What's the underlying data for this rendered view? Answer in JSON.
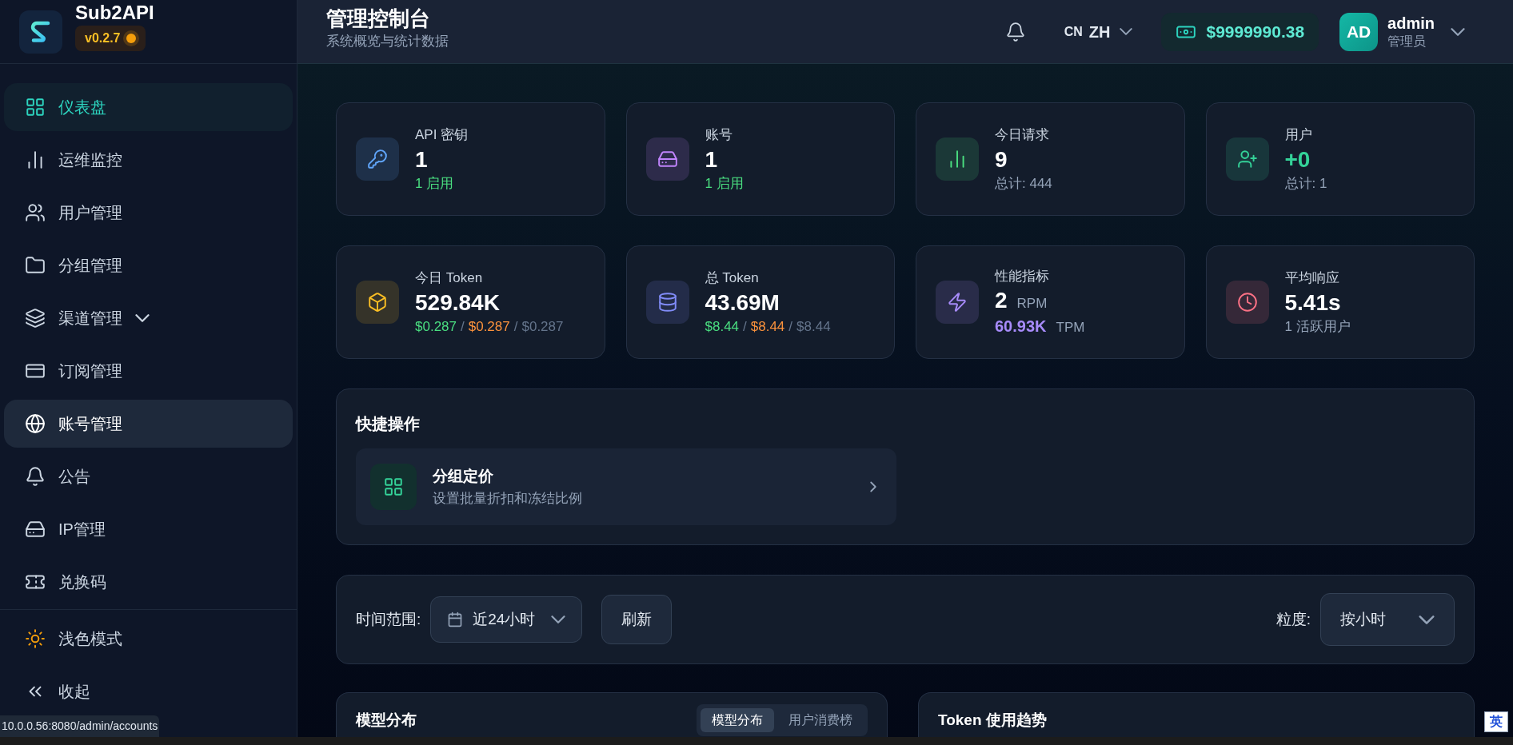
{
  "app": {
    "name": "Sub2API",
    "version": "v0.2.7"
  },
  "header": {
    "title": "管理控制台",
    "subtitle": "系统概览与统计数据",
    "language": {
      "code": "CN",
      "label": "ZH"
    },
    "balance": "$9999990.38",
    "user": {
      "initials": "AD",
      "name": "admin",
      "role": "管理员"
    }
  },
  "sidebar": {
    "items": [
      {
        "label": "仪表盘",
        "kind": "link",
        "selected": true,
        "hovered": false
      },
      {
        "label": "运维监控",
        "kind": "link",
        "selected": false,
        "hovered": false
      },
      {
        "label": "用户管理",
        "kind": "link",
        "selected": false,
        "hovered": false
      },
      {
        "label": "分组管理",
        "kind": "link",
        "selected": false,
        "hovered": false
      },
      {
        "label": "渠道管理",
        "kind": "group",
        "selected": false,
        "hovered": false
      },
      {
        "label": "订阅管理",
        "kind": "link",
        "selected": false,
        "hovered": false
      },
      {
        "label": "账号管理",
        "kind": "link",
        "selected": false,
        "hovered": true
      },
      {
        "label": "公告",
        "kind": "link",
        "selected": false,
        "hovered": false
      },
      {
        "label": "IP管理",
        "kind": "link",
        "selected": false,
        "hovered": false
      },
      {
        "label": "兑换码",
        "kind": "link",
        "selected": false,
        "hovered": false
      }
    ],
    "footer": [
      {
        "label": "浅色模式"
      },
      {
        "label": "收起"
      }
    ]
  },
  "stats": [
    {
      "label": "API 密钥",
      "value": "1",
      "color": "#60a5fa",
      "kind": "status",
      "note": "1 启用",
      "positive": false
    },
    {
      "label": "账号",
      "value": "1",
      "color": "#c084fc",
      "kind": "status",
      "note": "1 启用",
      "positive": false
    },
    {
      "label": "今日请求",
      "value": "9",
      "color": "#4ade80",
      "kind": "total",
      "note": "总计: 444",
      "positive": false
    },
    {
      "label": "用户",
      "value": "+0",
      "color": "#34d399",
      "kind": "total",
      "note": "总计: 1",
      "positive": true
    },
    {
      "label": "今日 Token",
      "value": "529.84K",
      "color": "#fbbf24",
      "kind": "cost",
      "costs": [
        "$0.287",
        "$0.287",
        "$0.287"
      ],
      "separator": "/",
      "positive": false
    },
    {
      "label": "总 Token",
      "value": "43.69M",
      "color": "#818cf8",
      "kind": "cost",
      "costs": [
        "$8.44",
        "$8.44",
        "$8.44"
      ],
      "separator": "/",
      "positive": false
    },
    {
      "label": "性能指标",
      "value": "2",
      "unit": "RPM",
      "color": "#a78bfa",
      "kind": "perf",
      "second": "60.93K",
      "second_unit": "TPM",
      "positive": false
    },
    {
      "label": "平均响应",
      "value": "5.41s",
      "color": "#fb7185",
      "kind": "total",
      "note": "1 活跃用户",
      "positive": false
    }
  ],
  "quick_actions": {
    "title": "快捷操作",
    "items": [
      {
        "title": "分组定价",
        "description": "设置批量折扣和冻结比例"
      }
    ]
  },
  "filters": {
    "time_range": {
      "label": "时间范围:",
      "value": "近24小时"
    },
    "refresh": "刷新",
    "granularity": {
      "label": "粒度:",
      "value": "按小时"
    }
  },
  "model_card": {
    "title": "模型分布",
    "tabs": [
      {
        "label": "模型分布",
        "selected": true
      },
      {
        "label": "用户消费榜",
        "selected": false
      }
    ]
  },
  "trend_card": {
    "title": "Token 使用趋势"
  },
  "status_url": "10.0.0.56:8080/admin/accounts",
  "ime_indicator": "英"
}
